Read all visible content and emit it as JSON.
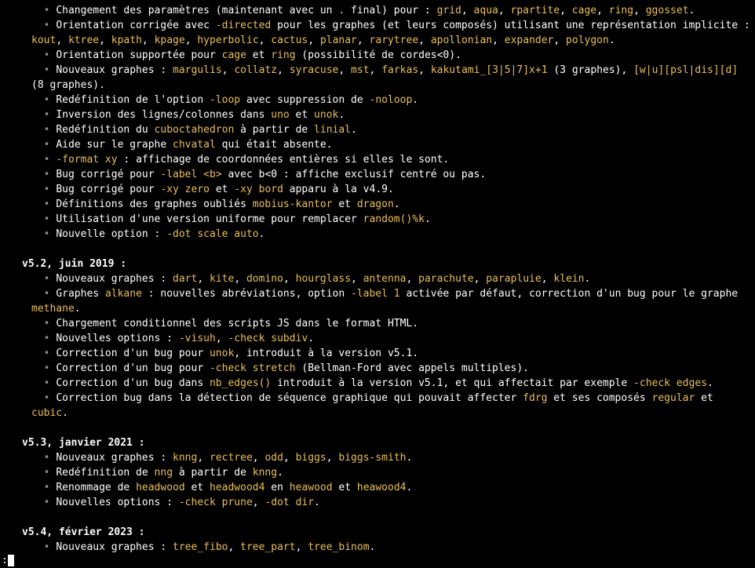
{
  "status_prompt": ":",
  "sections": [
    {
      "items": [
        {
          "type": "li",
          "segments": [
            {
              "t": "Changement des paramètres (maintenant avec un "
            },
            {
              "t": ".",
              "c": "hl"
            },
            {
              "t": " final) pour : "
            },
            {
              "t": "grid",
              "c": "hl"
            },
            {
              "t": ", "
            },
            {
              "t": "aqua",
              "c": "hl"
            },
            {
              "t": ", "
            },
            {
              "t": "rpartite",
              "c": "hl"
            },
            {
              "t": ", "
            },
            {
              "t": "cage",
              "c": "hl"
            },
            {
              "t": ", "
            },
            {
              "t": "ring",
              "c": "hl"
            },
            {
              "t": ", "
            },
            {
              "t": "ggosset",
              "c": "hl"
            },
            {
              "t": "."
            }
          ]
        },
        {
          "type": "li",
          "segments": [
            {
              "t": "Orientation corrigée avec "
            },
            {
              "t": "-directed",
              "c": "hl"
            },
            {
              "t": " pour les graphes (et leurs composés) utilisant une représentation implicite : "
            },
            {
              "t": "kout",
              "c": "hl"
            },
            {
              "t": ", "
            },
            {
              "t": "ktree",
              "c": "hl"
            },
            {
              "t": ", "
            },
            {
              "t": "kpath",
              "c": "hl"
            },
            {
              "t": ", "
            },
            {
              "t": "kpage",
              "c": "hl"
            },
            {
              "t": ", "
            },
            {
              "t": "hyperbolic",
              "c": "hl"
            },
            {
              "t": ", "
            },
            {
              "t": "cactus",
              "c": "hl"
            },
            {
              "t": ", "
            },
            {
              "t": "planar",
              "c": "hl"
            },
            {
              "t": ", "
            },
            {
              "t": "rarytree",
              "c": "hl"
            },
            {
              "t": ", "
            },
            {
              "t": "apollonian",
              "c": "hl"
            },
            {
              "t": ", "
            },
            {
              "t": "expander",
              "c": "hl"
            },
            {
              "t": ", "
            },
            {
              "t": "polygon",
              "c": "hl"
            },
            {
              "t": "."
            }
          ]
        },
        {
          "type": "li",
          "segments": [
            {
              "t": "Orientation supportée pour "
            },
            {
              "t": "cage",
              "c": "hl"
            },
            {
              "t": " et "
            },
            {
              "t": "ring",
              "c": "hl"
            },
            {
              "t": " (possibilité de cordes<0)."
            }
          ]
        },
        {
          "type": "li",
          "segments": [
            {
              "t": "Nouveaux graphes : "
            },
            {
              "t": "margulis",
              "c": "hl"
            },
            {
              "t": ", "
            },
            {
              "t": "collatz",
              "c": "hl"
            },
            {
              "t": ", "
            },
            {
              "t": "syracuse",
              "c": "hl"
            },
            {
              "t": ", "
            },
            {
              "t": "mst",
              "c": "hl"
            },
            {
              "t": ", "
            },
            {
              "t": "farkas",
              "c": "hl"
            },
            {
              "t": ", "
            },
            {
              "t": "kakutami_[3|5|7]x+1",
              "c": "hl"
            },
            {
              "t": " (3 graphes), "
            },
            {
              "t": "[w|u][psl|dis][d]",
              "c": "hl"
            },
            {
              "t": " (8 graphes)."
            }
          ]
        },
        {
          "type": "li",
          "segments": [
            {
              "t": "Redéfinition de l'option "
            },
            {
              "t": "-loop",
              "c": "hl"
            },
            {
              "t": " avec suppression de "
            },
            {
              "t": "-noloop",
              "c": "hl"
            },
            {
              "t": "."
            }
          ]
        },
        {
          "type": "li",
          "segments": [
            {
              "t": "Inversion des lignes/colonnes dans "
            },
            {
              "t": "uno",
              "c": "hl"
            },
            {
              "t": " et "
            },
            {
              "t": "unok",
              "c": "hl"
            },
            {
              "t": "."
            }
          ]
        },
        {
          "type": "li",
          "segments": [
            {
              "t": "Redéfinition du "
            },
            {
              "t": "cuboctahedron",
              "c": "hl"
            },
            {
              "t": " à partir de "
            },
            {
              "t": "linial",
              "c": "hl"
            },
            {
              "t": "."
            }
          ]
        },
        {
          "type": "li",
          "segments": [
            {
              "t": "Aide sur le graphe "
            },
            {
              "t": "chvatal",
              "c": "hl"
            },
            {
              "t": " qui était absente."
            }
          ]
        },
        {
          "type": "li",
          "segments": [
            {
              "t": "-format xy",
              "c": "hl"
            },
            {
              "t": " : affichage de coordonnées entières si elles le sont."
            }
          ]
        },
        {
          "type": "li",
          "segments": [
            {
              "t": "Bug corrigé pour "
            },
            {
              "t": "-label <b>",
              "c": "hl"
            },
            {
              "t": " avec b<0 : affiche exclusif centré ou pas."
            }
          ]
        },
        {
          "type": "li",
          "segments": [
            {
              "t": "Bug corrigé pour "
            },
            {
              "t": "-xy zero",
              "c": "hl"
            },
            {
              "t": " et "
            },
            {
              "t": "-xy bord",
              "c": "hl"
            },
            {
              "t": " apparu à la v4.9."
            }
          ]
        },
        {
          "type": "li",
          "segments": [
            {
              "t": "Définitions des graphes oubliés "
            },
            {
              "t": "mobius-kantor",
              "c": "hl"
            },
            {
              "t": " et "
            },
            {
              "t": "dragon",
              "c": "hl"
            },
            {
              "t": "."
            }
          ]
        },
        {
          "type": "li",
          "segments": [
            {
              "t": "Utilisation d'une version uniforme pour remplacer "
            },
            {
              "t": "random()%k",
              "c": "hl"
            },
            {
              "t": "."
            }
          ]
        },
        {
          "type": "li",
          "segments": [
            {
              "t": "Nouvelle option : "
            },
            {
              "t": "-dot scale auto",
              "c": "hl"
            },
            {
              "t": "."
            }
          ]
        }
      ]
    },
    {
      "heading": "v5.2, juin 2019 :",
      "items": [
        {
          "type": "li",
          "segments": [
            {
              "t": "Nouveaux graphes : "
            },
            {
              "t": "dart",
              "c": "hl"
            },
            {
              "t": ", "
            },
            {
              "t": "kite",
              "c": "hl"
            },
            {
              "t": ", "
            },
            {
              "t": "domino",
              "c": "hl"
            },
            {
              "t": ", "
            },
            {
              "t": "hourglass",
              "c": "hl"
            },
            {
              "t": ", "
            },
            {
              "t": "antenna",
              "c": "hl"
            },
            {
              "t": ", "
            },
            {
              "t": "parachute",
              "c": "hl"
            },
            {
              "t": ", "
            },
            {
              "t": "parapluie",
              "c": "hl"
            },
            {
              "t": ", "
            },
            {
              "t": "klein",
              "c": "hl"
            },
            {
              "t": "."
            }
          ]
        },
        {
          "type": "li",
          "segments": [
            {
              "t": "Graphes "
            },
            {
              "t": "alkane",
              "c": "hl"
            },
            {
              "t": " : nouvelles abréviations, option "
            },
            {
              "t": "-label 1",
              "c": "hl"
            },
            {
              "t": " activée par défaut, correction d'un bug pour le graphe "
            },
            {
              "t": "methane",
              "c": "hl"
            },
            {
              "t": "."
            }
          ]
        },
        {
          "type": "li",
          "segments": [
            {
              "t": "Chargement conditionnel des scripts JS dans le format HTML."
            }
          ]
        },
        {
          "type": "li",
          "segments": [
            {
              "t": "Nouvelles options : "
            },
            {
              "t": "-visuh",
              "c": "hl"
            },
            {
              "t": ", "
            },
            {
              "t": "-check subdiv",
              "c": "hl"
            },
            {
              "t": "."
            }
          ]
        },
        {
          "type": "li",
          "segments": [
            {
              "t": "Correction d'un bug pour "
            },
            {
              "t": "unok",
              "c": "hl"
            },
            {
              "t": ", introduit à la version v5.1."
            }
          ]
        },
        {
          "type": "li",
          "segments": [
            {
              "t": "Correction d'un bug pour "
            },
            {
              "t": "-check stretch",
              "c": "hl"
            },
            {
              "t": " (Bellman-Ford avec appels multiples)."
            }
          ]
        },
        {
          "type": "li",
          "segments": [
            {
              "t": "Correction d'un bug dans "
            },
            {
              "t": "nb_edges()",
              "c": "hl"
            },
            {
              "t": " introduit à la version v5.1, et qui affectait par exemple "
            },
            {
              "t": "-check edges",
              "c": "hl"
            },
            {
              "t": "."
            }
          ]
        },
        {
          "type": "li",
          "segments": [
            {
              "t": "Correction bug dans la détection de séquence graphique qui pouvait affecter "
            },
            {
              "t": "fdrg",
              "c": "hl"
            },
            {
              "t": " et ses composés "
            },
            {
              "t": "regular",
              "c": "hl"
            },
            {
              "t": " et "
            },
            {
              "t": "cubic",
              "c": "hl"
            },
            {
              "t": "."
            }
          ]
        }
      ]
    },
    {
      "heading": "v5.3, janvier 2021 :",
      "items": [
        {
          "type": "li",
          "segments": [
            {
              "t": "Nouveaux graphes : "
            },
            {
              "t": "knng",
              "c": "hl"
            },
            {
              "t": ", "
            },
            {
              "t": "rectree",
              "c": "hl"
            },
            {
              "t": ", "
            },
            {
              "t": "odd",
              "c": "hl"
            },
            {
              "t": ", "
            },
            {
              "t": "biggs",
              "c": "hl"
            },
            {
              "t": ", "
            },
            {
              "t": "biggs-smith",
              "c": "hl"
            },
            {
              "t": "."
            }
          ]
        },
        {
          "type": "li",
          "segments": [
            {
              "t": "Redéfinition de "
            },
            {
              "t": "nng",
              "c": "hl"
            },
            {
              "t": " à partir de "
            },
            {
              "t": "knng",
              "c": "hl"
            },
            {
              "t": "."
            }
          ]
        },
        {
          "type": "li",
          "segments": [
            {
              "t": "Renommage de "
            },
            {
              "t": "headwood",
              "c": "hl"
            },
            {
              "t": " et "
            },
            {
              "t": "headwood4",
              "c": "hl"
            },
            {
              "t": " en "
            },
            {
              "t": "heawood",
              "c": "hl"
            },
            {
              "t": " et "
            },
            {
              "t": "heawood4",
              "c": "hl"
            },
            {
              "t": "."
            }
          ]
        },
        {
          "type": "li",
          "segments": [
            {
              "t": "Nouvelles options : "
            },
            {
              "t": "-check prune",
              "c": "hl"
            },
            {
              "t": ", "
            },
            {
              "t": "-dot dir",
              "c": "hl"
            },
            {
              "t": "."
            }
          ]
        }
      ]
    },
    {
      "heading": "v5.4, février 2023 :",
      "items": [
        {
          "type": "li",
          "segments": [
            {
              "t": "Nouveaux graphes : "
            },
            {
              "t": "tree_fibo",
              "c": "hl"
            },
            {
              "t": ", "
            },
            {
              "t": "tree_part",
              "c": "hl"
            },
            {
              "t": ", "
            },
            {
              "t": "tree_binom",
              "c": "hl"
            },
            {
              "t": "."
            }
          ]
        }
      ]
    }
  ]
}
